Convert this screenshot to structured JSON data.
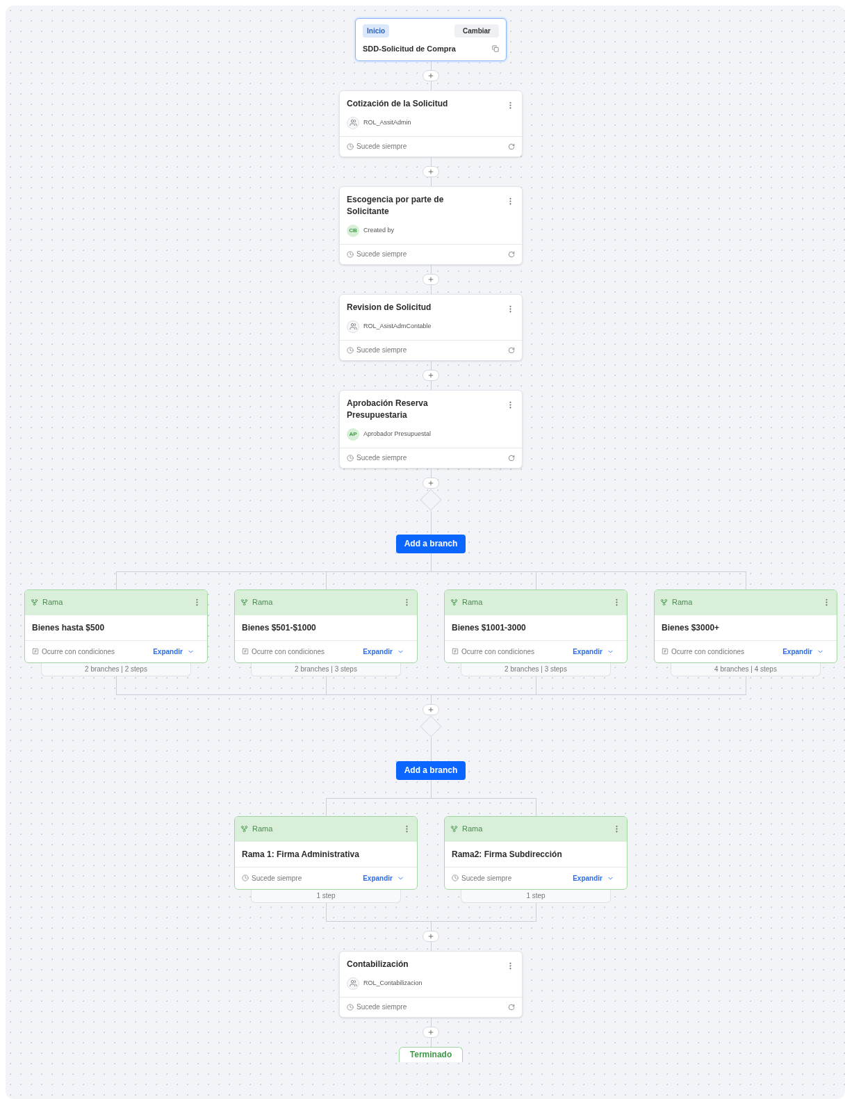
{
  "start": {
    "badge": "Inicio",
    "button": "Cambiar",
    "title": "SDD-Solicitud de Compra"
  },
  "flow": [
    {
      "kind": "step",
      "title": "Cotización de la Solicitud",
      "assignee": {
        "kind": "role",
        "label": "ROL_AssitAdmin"
      },
      "condition": "Sucede siempre"
    },
    {
      "kind": "step",
      "title": "Escogencia por parte de Solicitante",
      "assignee": {
        "kind": "user",
        "initials": "CB",
        "label": "Created by"
      },
      "condition": "Sucede siempre"
    },
    {
      "kind": "step",
      "title": "Revision de Solicitud",
      "assignee": {
        "kind": "role",
        "label": "ROL_AsistAdmContable"
      },
      "condition": "Sucede siempre"
    },
    {
      "kind": "step",
      "title": "Aprobación Reserva Presupuestaria",
      "assignee": {
        "kind": "user",
        "initials": "AP",
        "label": "Aprobador Presupuestal"
      },
      "condition": "Sucede siempre"
    },
    {
      "kind": "branches",
      "button": "Add a branch",
      "branches": [
        {
          "header": "Rama",
          "title": "Bienes hasta $500",
          "condition": {
            "kind": "formula",
            "text": "Ocurre con condiciones"
          },
          "expand": "Expandir",
          "summary": "2 branches | 2 steps"
        },
        {
          "header": "Rama",
          "title": "Bienes $501-$1000",
          "condition": {
            "kind": "formula",
            "text": "Ocurre con condiciones"
          },
          "expand": "Expandir",
          "summary": "2 branches | 3 steps"
        },
        {
          "header": "Rama",
          "title": "Bienes $1001-3000",
          "condition": {
            "kind": "formula",
            "text": "Ocurre con condiciones"
          },
          "expand": "Expandir",
          "summary": "2 branches | 3 steps"
        },
        {
          "header": "Rama",
          "title": "Bienes $3000+",
          "condition": {
            "kind": "formula",
            "text": "Ocurre con condiciones"
          },
          "expand": "Expandir",
          "summary": "4 branches | 4 steps"
        }
      ]
    },
    {
      "kind": "branches",
      "button": "Add a branch",
      "branches": [
        {
          "header": "Rama",
          "title": "Rama 1: Firma Administrativa",
          "condition": {
            "kind": "always",
            "text": "Sucede siempre"
          },
          "expand": "Expandir",
          "summary": "1 step"
        },
        {
          "header": "Rama",
          "title": "Rama2: Firma Subdirección",
          "condition": {
            "kind": "always",
            "text": "Sucede siempre"
          },
          "expand": "Expandir",
          "summary": "1 step"
        }
      ]
    },
    {
      "kind": "step",
      "title": "Contabilización",
      "assignee": {
        "kind": "role",
        "label": "ROL_Contabilizacion"
      },
      "condition": "Sucede siempre"
    },
    {
      "kind": "end",
      "label": "Terminado"
    }
  ]
}
